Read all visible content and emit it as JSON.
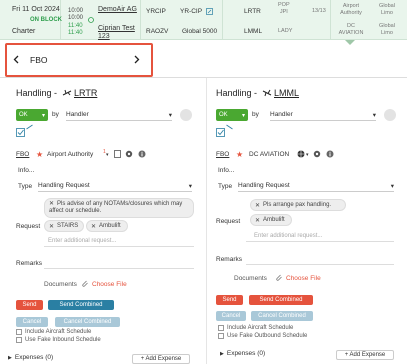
{
  "header": {
    "date": "Fri 11 Oct 2024",
    "on_block": "ON BLOCK",
    "type": "Charter",
    "times_top": [
      "10:00",
      "10:00"
    ],
    "times_bottom": [
      "11:40",
      "11:40"
    ],
    "operator": "DemoAir AG",
    "client": "Ciprian Test 123",
    "origin_code": "YRCIP",
    "aircraft": "RAOZV",
    "origin_label": "YR-CIP",
    "aircraft_type": "Global 5000",
    "dep_icao": "LRTR",
    "arr_icao": "LMML",
    "pop_jpi": "POP\nJPI",
    "pax_label": "LADY",
    "ratio": "13/13",
    "airport_authority": "Airport\nAuthority",
    "dc_aviation": "DC\nAVIATION",
    "global_limo_1": "Global\nLimo",
    "global_limo_2": "Global\nLimo"
  },
  "fbo_selector": {
    "label": "FBO"
  },
  "left": {
    "title_prefix": "Handling - ",
    "title_code": "LRTR",
    "status": "OK",
    "by": "by",
    "handler_placeholder": "Handler",
    "fbo_label": "FBO",
    "fbo_value": "Airport Authority",
    "info_label": "Info...",
    "type_label": "Type",
    "type_value": "Handling Request",
    "request_label": "Request",
    "chip_notams": "Pls advise of any NOTAMs/closures which may affect our schedule.",
    "chip_stairs": "STAIRS",
    "chip_ambulift": "Ambulift",
    "request_placeholder": "Enter additional request...",
    "remarks_label": "Remarks",
    "documents_label": "Documents",
    "choose_file": "Choose File",
    "send": "Send",
    "send_combined": "Send Combined",
    "cancel": "Cancel",
    "cancel_combined": "Cancel Combined",
    "include_schedule": "Include Aircraft Schedule",
    "use_schedule": "Use Fake Inbound Schedule",
    "expenses": "Expenses (0)",
    "add_expense": "+ Add Expense"
  },
  "right": {
    "title_prefix": "Handling - ",
    "title_code": "LMML",
    "status": "OK",
    "by": "by",
    "handler_placeholder": "Handler",
    "fbo_label": "FBO",
    "fbo_value": "DC AVIATION",
    "info_label": "Info...",
    "type_label": "Type",
    "type_value": "Handling Request",
    "request_label": "Request",
    "chip_pax": "Pls arrange pax handling.",
    "chip_ambulift": "Ambulift",
    "request_placeholder": "Enter additional request...",
    "remarks_label": "Remarks",
    "documents_label": "Documents",
    "choose_file": "Choose File",
    "send": "Send",
    "send_combined": "Send Combined",
    "cancel": "Cancel",
    "cancel_combined": "Cancel Combined",
    "include_schedule": "Include Aircraft Schedule",
    "use_schedule": "Use Fake Outbound Schedule",
    "expenses": "Expenses (0)",
    "add_expense": "+ Add Expense"
  },
  "colors": {
    "accent": "#e5533d",
    "ok_green": "#4aa831",
    "blue": "#2a7fa3",
    "header_bg": "#e9f5ec"
  }
}
